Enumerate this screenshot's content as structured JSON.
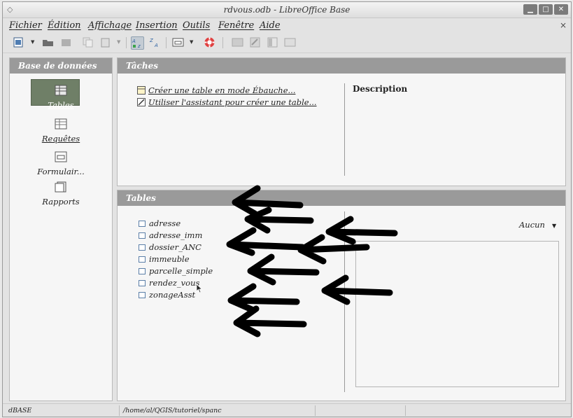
{
  "window": {
    "title": "rdvous.odb - LibreOffice Base",
    "minimize": "▁",
    "maximize": "□",
    "close": "✕"
  },
  "menu": {
    "items": [
      "Fichier",
      "Édition",
      "Affichage",
      "Insertion",
      "Outils",
      "Fenêtre",
      "Aide"
    ],
    "close_doc": "×"
  },
  "toolbar": {
    "icons": [
      "new-document-icon",
      "open-icon",
      "save-icon",
      "copy-icon",
      "paste-icon",
      "sort-ascending-icon",
      "sort-descending-icon",
      "form-icon",
      "help-lifebuoy-icon",
      "table-icon",
      "edit-icon",
      "view-icon",
      "delete-icon"
    ]
  },
  "database_panel": {
    "header": "Base de données",
    "items": [
      {
        "label": "Tables",
        "icon": "tables-icon",
        "selected": true
      },
      {
        "label": "Requêtes",
        "icon": "queries-icon",
        "selected": false
      },
      {
        "label": "Formulair...",
        "icon": "forms-icon",
        "selected": false
      },
      {
        "label": "Rapports",
        "icon": "reports-icon",
        "selected": false
      }
    ]
  },
  "tasks_panel": {
    "header": "Tâches",
    "tasks": [
      "Créer une table en mode Ébauche...",
      "Utiliser l'assistant pour créer une table..."
    ],
    "description_label": "Description"
  },
  "tables_panel": {
    "header": "Tables",
    "tables": [
      "adresse",
      "adresse_imm",
      "dossier_ANC",
      "immeuble",
      "parcelle_simple",
      "rendez_vous",
      "zonageAsst"
    ],
    "preview_option": "Aucun"
  },
  "statusbar": {
    "db_type": "dBASE",
    "path": "/home/al/QGIS/tutoriel/spanc"
  },
  "colors": {
    "panel_header": "#9a9a9a",
    "selected_item": "#6f7f67",
    "annotation": "#000000"
  }
}
